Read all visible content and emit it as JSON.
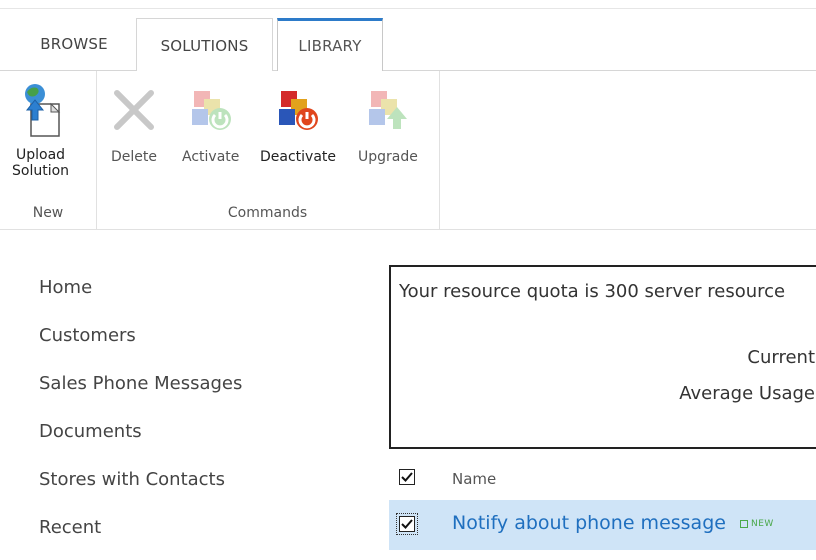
{
  "ribbon_tabs": [
    {
      "label": "BROWSE"
    },
    {
      "label": "SOLUTIONS"
    },
    {
      "label": "LIBRARY"
    }
  ],
  "ribbon": {
    "groups": [
      {
        "label": "New",
        "buttons": [
          {
            "label": "Upload Solution",
            "icon": "upload-solution-icon",
            "enabled": true
          }
        ]
      },
      {
        "label": "Commands",
        "buttons": [
          {
            "label": "Delete",
            "icon": "delete-icon",
            "enabled": false
          },
          {
            "label": "Activate",
            "icon": "activate-icon",
            "enabled": false
          },
          {
            "label": "Deactivate",
            "icon": "deactivate-icon",
            "enabled": true
          },
          {
            "label": "Upgrade",
            "icon": "upgrade-icon",
            "enabled": false
          }
        ]
      }
    ]
  },
  "nav": {
    "items": [
      {
        "label": "Home"
      },
      {
        "label": "Customers"
      },
      {
        "label": "Sales Phone Messages"
      },
      {
        "label": "Documents"
      },
      {
        "label": "Stores with Contacts"
      },
      {
        "label": "Recent"
      }
    ]
  },
  "quota": {
    "line1": "Your resource quota is 300 server resource",
    "line2": "Current",
    "line3": "Average Usage"
  },
  "list": {
    "column_name": "Name",
    "header_checked": true,
    "rows": [
      {
        "name": "Notify about phone message",
        "badge": "NEW",
        "checked": true,
        "selected": true
      }
    ]
  },
  "colors": {
    "link": "#1f6fbf",
    "selected_row": "#cfe4f7",
    "tab_accent": "#2d7bc9"
  }
}
